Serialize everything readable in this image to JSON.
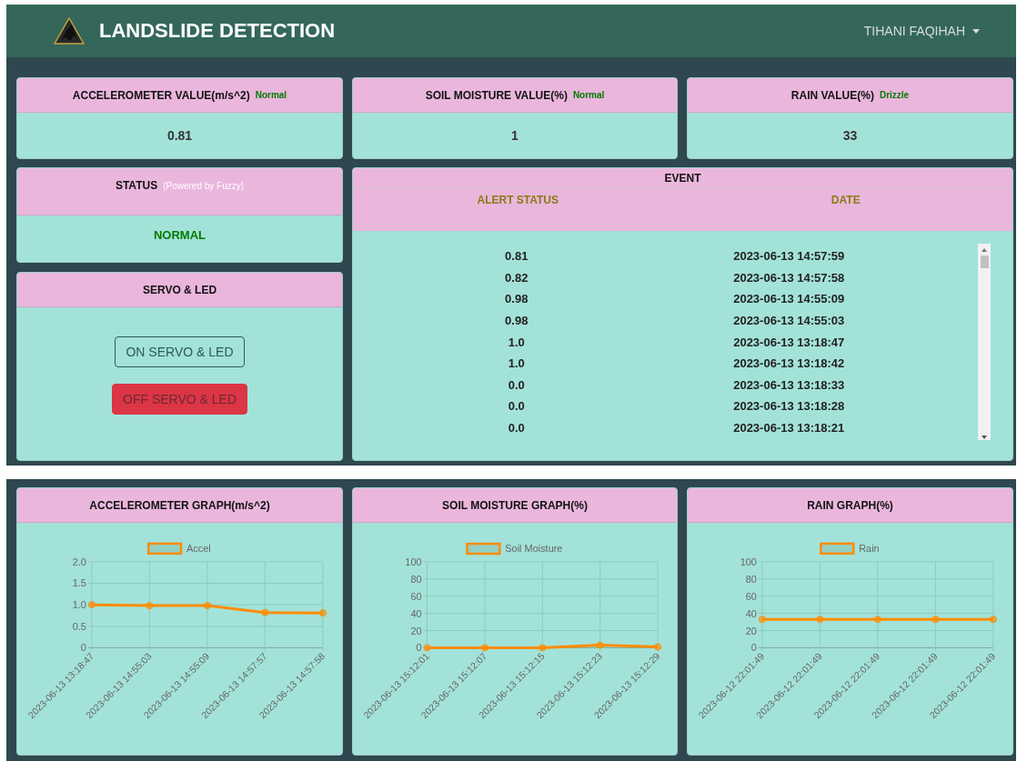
{
  "navbar": {
    "title": "LANDSLIDE DETECTION",
    "user": "TIHANI FAQIHAH"
  },
  "value_cards": [
    {
      "title": "ACCELEROMETER VALUE(m/s^2)",
      "badge": "Normal",
      "value": "0.81"
    },
    {
      "title": "SOIL MOISTURE VALUE(%)",
      "badge": "Normal",
      "value": "1"
    },
    {
      "title": "RAIN VALUE(%)",
      "badge": "Drizzle",
      "value": "33"
    }
  ],
  "status_card": {
    "title": "STATUS",
    "subtitle": "(Powered by Fuzzy)",
    "value": "NORMAL"
  },
  "servo_card": {
    "title": "SERVO & LED",
    "buttons": [
      {
        "label": "ON SERVO & LED",
        "kind": "outline"
      },
      {
        "label": "OFF SERVO & LED",
        "kind": "danger"
      }
    ]
  },
  "event_table": {
    "title": "EVENT",
    "columns": [
      "ALERT STATUS",
      "DATE"
    ],
    "rows": [
      [
        "0.81",
        "2023-06-13 14:57:59"
      ],
      [
        "0.82",
        "2023-06-13 14:57:58"
      ],
      [
        "0.98",
        "2023-06-13 14:55:09"
      ],
      [
        "0.98",
        "2023-06-13 14:55:03"
      ],
      [
        "1.0",
        "2023-06-13 13:18:47"
      ],
      [
        "1.0",
        "2023-06-13 13:18:42"
      ],
      [
        "0.0",
        "2023-06-13 13:18:33"
      ],
      [
        "0.0",
        "2023-06-13 13:18:28"
      ],
      [
        "0.0",
        "2023-06-13 13:18:21"
      ]
    ]
  },
  "graphs": [
    {
      "title": "ACCELEROMETER GRAPH(m/s^2)",
      "chart_data": {
        "type": "line",
        "categories": [
          "2023-06-13 13:18:47",
          "2023-06-13 14:55:03",
          "2023-06-13 14:55:09",
          "2023-06-13 14:57:57",
          "2023-06-13 14:57:58"
        ],
        "grid": true,
        "series": [
          {
            "name": "Accel",
            "color": "#ff8c00",
            "marker": true,
            "values": [
              1.0,
              0.98,
              0.98,
              0.82,
              0.81
            ]
          }
        ],
        "ylim": [
          0,
          2
        ],
        "yticks": [
          0,
          {
            "value": 0.5,
            "label": "0.5"
          },
          {
            "value": 1,
            "label": "1.0"
          },
          {
            "value": 1.5,
            "label": "1.5"
          },
          {
            "value": 2,
            "label": "2.0"
          }
        ]
      }
    },
    {
      "title": "SOIL MOISTURE GRAPH(%)",
      "chart_data": {
        "type": "line",
        "categories": [
          "2023-06-13 15:12:01",
          "2023-06-13 15:12:07",
          "2023-06-13 15:12:15",
          "2023-06-13 15:12:23",
          "2023-06-13 15:12:29"
        ],
        "grid": true,
        "series": [
          {
            "name": "Soil Moisture",
            "color": "#ff8c00",
            "marker": true,
            "values": [
              0,
              0,
              0,
              3,
              1
            ]
          }
        ],
        "ylim": [
          0,
          100
        ],
        "yticks": [
          0,
          20,
          40,
          60,
          80,
          100
        ]
      }
    },
    {
      "title": "RAIN GRAPH(%)",
      "chart_data": {
        "type": "line",
        "categories": [
          "2023-06-12 22:01:49",
          "2023-06-12 22:01:49",
          "2023-06-12 22:01:49",
          "2023-06-12 22:01:49",
          "2023-06-12 22:01:49"
        ],
        "grid": true,
        "series": [
          {
            "name": "Rain",
            "color": "#ff8c00",
            "marker": true,
            "values": [
              33,
              33,
              33,
              33,
              33
            ]
          }
        ],
        "ylim": [
          0,
          100
        ],
        "yticks": [
          0,
          20,
          40,
          60,
          80,
          100
        ]
      }
    }
  ]
}
